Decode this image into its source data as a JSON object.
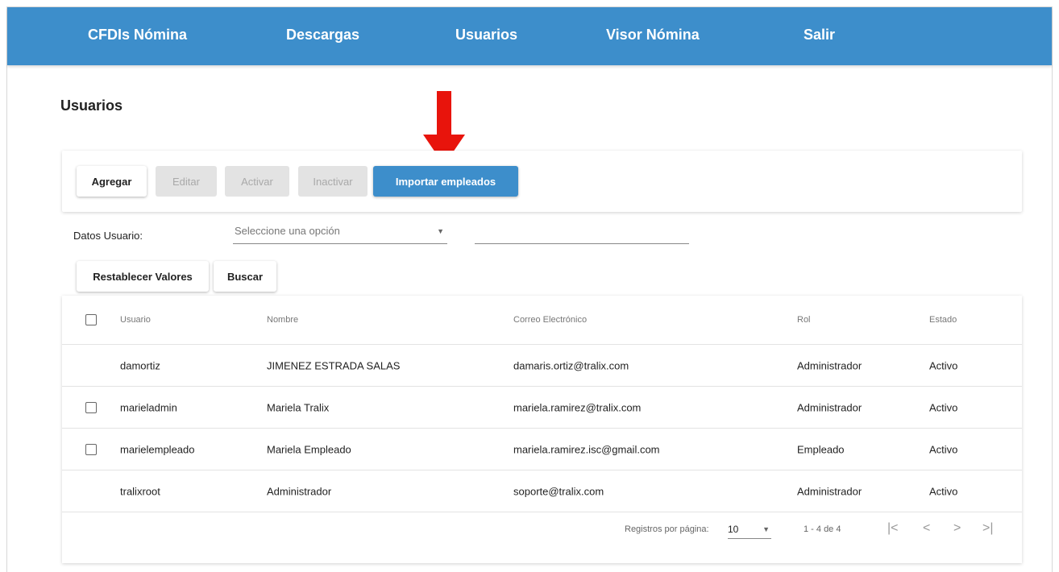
{
  "nav": {
    "items": [
      {
        "label": "CFDIs Nómina"
      },
      {
        "label": "Descargas"
      },
      {
        "label": "Usuarios"
      },
      {
        "label": "Visor Nómina"
      },
      {
        "label": "Salir"
      }
    ],
    "background_color": "#3d8ecb"
  },
  "page": {
    "title": "Usuarios"
  },
  "toolbar": {
    "add_label": "Agregar",
    "edit_label": "Editar",
    "activate_label": "Activar",
    "deactivate_label": "Inactivar",
    "import_label": "Importar empleados"
  },
  "filter": {
    "label": "Datos Usuario:",
    "select_placeholder": "Seleccione una opción",
    "text_value": ""
  },
  "actions": {
    "reset_label": "Restablecer Valores",
    "search_label": "Buscar"
  },
  "table": {
    "headers": {
      "user": "Usuario",
      "name": "Nombre",
      "email": "Correo Electrónico",
      "role": "Rol",
      "status": "Estado"
    },
    "rows": [
      {
        "user": "damortiz",
        "name": "JIMENEZ ESTRADA SALAS",
        "email": "damaris.ortiz@tralix.com",
        "role": "Administrador",
        "status": "Activo"
      },
      {
        "user": "marieladmin",
        "name": "Mariela Tralix",
        "email": "mariela.ramirez@tralix.com",
        "role": "Administrador",
        "status": "Activo"
      },
      {
        "user": "marielempleado",
        "name": "Mariela Empleado",
        "email": "mariela.ramirez.isc@gmail.com",
        "role": "Empleado",
        "status": "Activo"
      },
      {
        "user": "tralixroot",
        "name": "Administrador",
        "email": "soporte@tralix.com",
        "role": "Administrador",
        "status": "Activo"
      }
    ]
  },
  "paginator": {
    "page_size_label": "Registros por página:",
    "page_size": "10",
    "range_label": "1 - 4 de 4"
  },
  "annotation": {
    "arrow_color": "#e8140c"
  }
}
